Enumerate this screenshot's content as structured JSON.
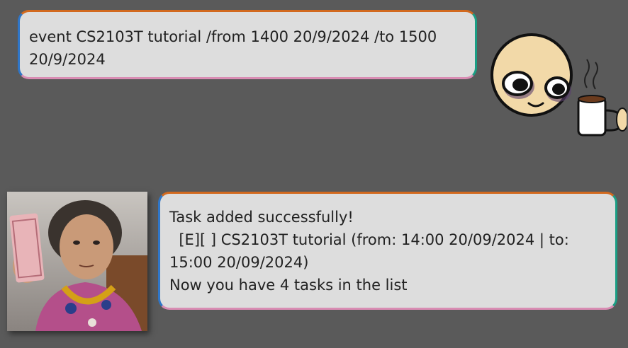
{
  "user_message": {
    "text": "event CS2103T tutorial /from 1400 20/9/2024 /to 1500 20/9/2024"
  },
  "bot_message": {
    "line1": "Task added successfully!",
    "line2": "  [E][ ] CS2103T tutorial (from: 14:00 20/09/2024 | to: 15:00 20/09/2024)",
    "line3": "Now you have 4 tasks in the list"
  },
  "colors": {
    "background": "#5a5a5a",
    "bubble": "#dddddd",
    "border_top": "#d2691e",
    "border_right": "#1a9e84",
    "border_bottom": "#d98cb3",
    "border_left": "#2f76c8"
  },
  "images": {
    "user_avatar": "tired-face-with-coffee",
    "bot_avatar": "woman-holding-money"
  }
}
